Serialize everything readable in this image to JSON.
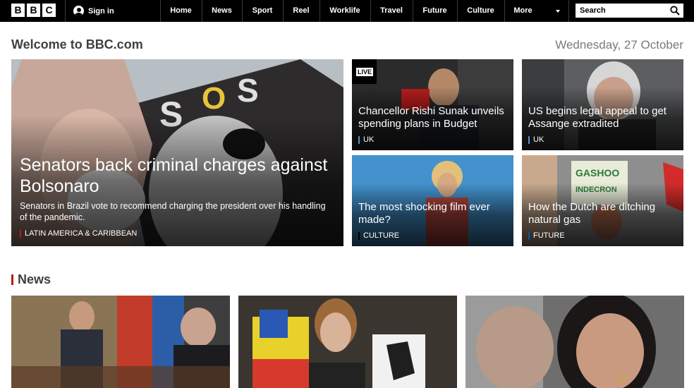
{
  "site": {
    "logo_letters": [
      "B",
      "B",
      "C"
    ]
  },
  "nav": {
    "sign_in": "Sign in",
    "items": [
      "Home",
      "News",
      "Sport",
      "Reel",
      "Worklife",
      "Travel",
      "Future",
      "Culture",
      "More"
    ],
    "search_placeholder": "Search"
  },
  "page": {
    "welcome": "Welcome to BBC.com",
    "date": "Wednesday, 27 October"
  },
  "promos": {
    "hero": {
      "headline": "Senators back criminal charges against Bolsonaro",
      "summary": "Senators in Brazil vote to recommend charging the president over his handling of the pandemic.",
      "tag": "LATIN AMERICA & CARIBBEAN"
    },
    "items": [
      {
        "headline": "Chancellor Rishi Sunak unveils spending plans in Budget",
        "tag": "UK",
        "live": "LIVE"
      },
      {
        "headline": "US begins legal appeal to get Assange extradited",
        "tag": "UK"
      },
      {
        "headline": "The most shocking film ever made?",
        "tag": "CULTURE"
      },
      {
        "headline": "How the Dutch are ditching natural gas",
        "tag": "FUTURE"
      }
    ]
  },
  "news": {
    "title": "News"
  },
  "colors": {
    "news_tag": "#bb1919",
    "uk_tag": "#5a8ed8",
    "culture_tag": "#000000",
    "future_tag": "#005a9c"
  },
  "icons": [
    "user-icon",
    "chevron-down-icon",
    "search-icon"
  ]
}
